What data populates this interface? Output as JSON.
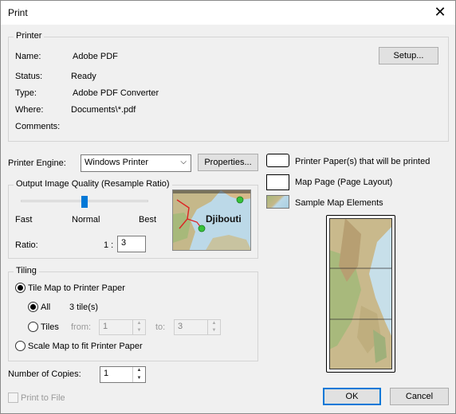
{
  "window": {
    "title": "Print"
  },
  "printer": {
    "group_label": "Printer",
    "name_label": "Name:",
    "name_value": "Adobe PDF",
    "status_label": "Status:",
    "status_value": "Ready",
    "type_label": "Type:",
    "type_value": "Adobe PDF Converter",
    "where_label": "Where:",
    "where_value": "Documents\\*.pdf",
    "comments_label": "Comments:",
    "setup_label": "Setup..."
  },
  "engine": {
    "label": "Printer Engine:",
    "value": "Windows Printer",
    "properties_label": "Properties..."
  },
  "quality": {
    "group_label": "Output Image Quality (Resample Ratio)",
    "fast": "Fast",
    "normal": "Normal",
    "best": "Best",
    "slider_level": 0.5,
    "ratio_label": "Ratio:",
    "ratio_prefix": "1 :",
    "ratio_value": "3",
    "thumb_text": "Djibouti"
  },
  "legend": {
    "paper": "Printer Paper(s) that will be printed",
    "map_page": "Map Page (Page Layout)",
    "sample": "Sample Map Elements"
  },
  "tiling": {
    "group_label": "Tiling",
    "tile_option": "Tile Map to Printer Paper",
    "all_option": "All",
    "tile_count": "3 tile(s)",
    "tiles_option": "Tiles",
    "from_label": "from:",
    "from_value": "1",
    "to_label": "to:",
    "to_value": "3",
    "scale_option": "Scale Map to fit Printer Paper"
  },
  "copies": {
    "label": "Number of Copies:",
    "value": "1"
  },
  "print_to_file": "Print to File",
  "ok": "OK",
  "cancel": "Cancel"
}
